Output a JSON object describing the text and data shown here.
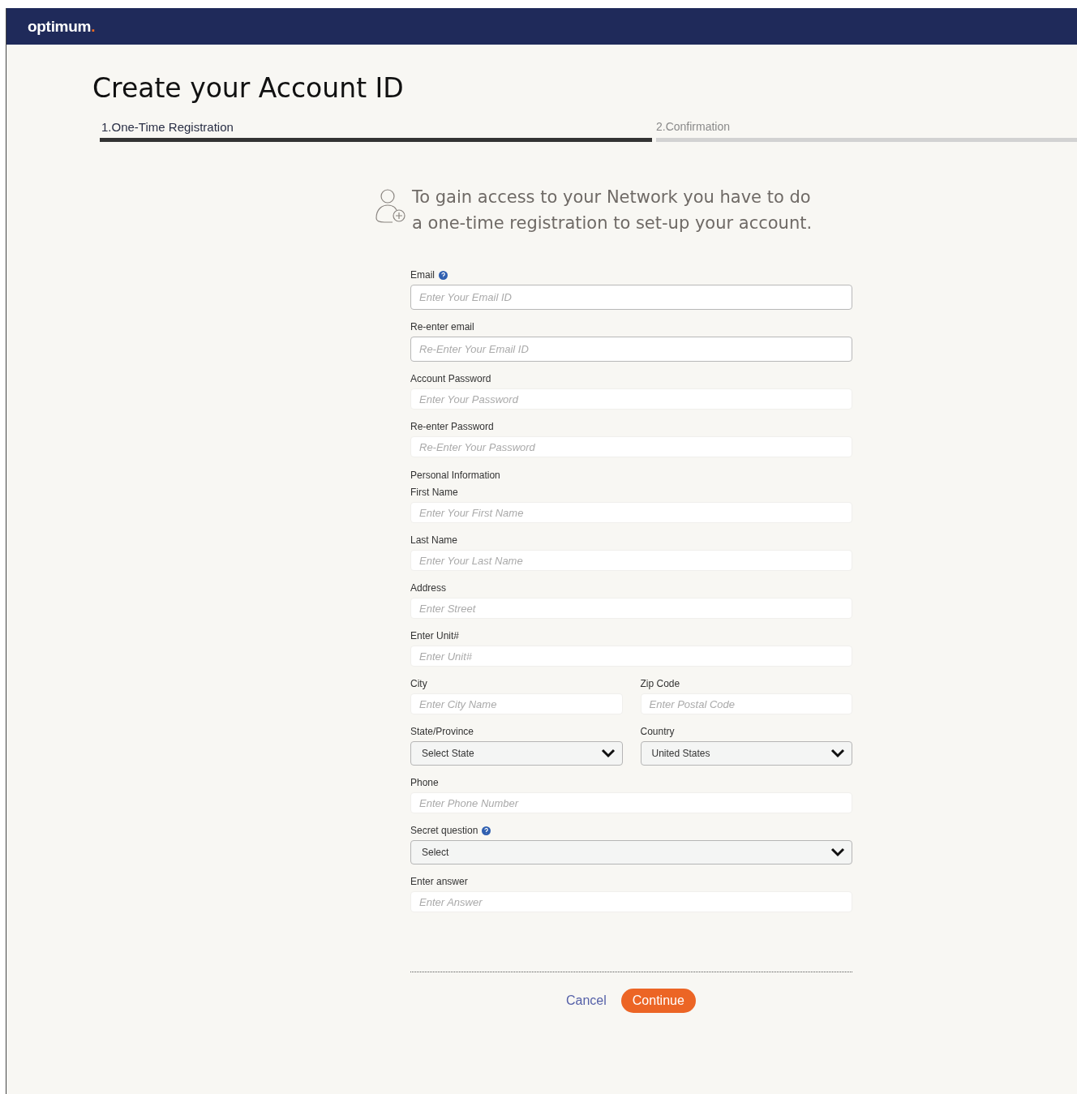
{
  "header": {
    "logo": "optimum",
    "logo_dot": "."
  },
  "title": "Create your Account ID",
  "steps": [
    {
      "label": "1.One-Time Registration",
      "selected": true
    },
    {
      "label": "2.Confirmation",
      "selected": false
    }
  ],
  "intro": {
    "line_1": "To gain access to your Network  you have to do",
    "line_2": "a one-time registration to set-up your account."
  },
  "form": [
    {
      "kind": "field",
      "fields": [
        {
          "kind": "input-outlined",
          "label": "Email",
          "help": true,
          "placeholder": "Enter Your Email ID"
        }
      ]
    },
    {
      "kind": "field",
      "fields": [
        {
          "kind": "input-outlined",
          "label": "Re-enter email",
          "help": false,
          "placeholder": "Re-Enter Your Email ID"
        }
      ]
    },
    {
      "kind": "field",
      "fields": [
        {
          "kind": "input",
          "label": "Account Password",
          "help": false,
          "placeholder": "Enter Your Password"
        }
      ]
    },
    {
      "kind": "field",
      "fields": [
        {
          "kind": "input",
          "label": "Re-enter Password",
          "help": false,
          "placeholder": "Re-Enter Your Password"
        }
      ]
    },
    {
      "kind": "heading",
      "text": "Personal Information"
    },
    {
      "kind": "field",
      "fields": [
        {
          "kind": "input",
          "label": "First Name",
          "help": false,
          "placeholder": "Enter Your First Name"
        }
      ]
    },
    {
      "kind": "field",
      "fields": [
        {
          "kind": "input",
          "label": "Last Name",
          "help": false,
          "placeholder": "Enter Your Last Name"
        }
      ]
    },
    {
      "kind": "field",
      "fields": [
        {
          "kind": "input",
          "label": "Address",
          "help": false,
          "placeholder": "Enter Street"
        }
      ]
    },
    {
      "kind": "field",
      "fields": [
        {
          "kind": "input",
          "label": "Enter Unit#",
          "help": false,
          "placeholder": "Enter Unit#"
        }
      ]
    },
    {
      "kind": "field",
      "fields": [
        {
          "kind": "input",
          "label": "City",
          "help": false,
          "placeholder": "Enter City Name"
        },
        {
          "kind": "input",
          "label": "Zip Code",
          "help": false,
          "placeholder": "Enter Postal Code"
        }
      ]
    },
    {
      "kind": "field",
      "fields": [
        {
          "kind": "select",
          "label": "State/Province",
          "help": false,
          "value": "Select State"
        },
        {
          "kind": "select",
          "label": "Country",
          "help": false,
          "value": "United States"
        }
      ]
    },
    {
      "kind": "field",
      "fields": [
        {
          "kind": "input",
          "label": "Phone",
          "help": false,
          "placeholder": "Enter Phone Number"
        }
      ]
    },
    {
      "kind": "field",
      "fields": [
        {
          "kind": "select",
          "label": "Secret question",
          "help": true,
          "value": "Select"
        }
      ]
    },
    {
      "kind": "field",
      "fields": [
        {
          "kind": "input",
          "label": "Enter answer",
          "help": false,
          "placeholder": "Enter Answer"
        }
      ]
    }
  ],
  "actions": {
    "cancel": "Cancel",
    "continue": "Continue"
  }
}
